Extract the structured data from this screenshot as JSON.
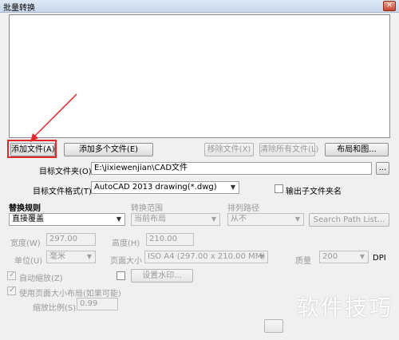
{
  "window": {
    "title": "批量转换",
    "close_glyph": "✕"
  },
  "buttons": {
    "add_file": "添加文件(A)",
    "add_multiple": "添加多个文件(E)",
    "remove_file": "移除文件(X)",
    "clear_all": "清除所有文件(L)",
    "layout_settings": "布局和图...",
    "browse": "...",
    "set_watermark": "设置水印..."
  },
  "target_folder": {
    "label": "目标文件夹(O)",
    "value": "E:\\jixiewenjian\\CAD文件"
  },
  "target_format": {
    "label": "目标文件格式(T)",
    "value": "AutoCAD 2013 drawing(*.dwg)"
  },
  "output_subfolder": {
    "label": "输出子文件夹名",
    "checked": false
  },
  "replace_rule": {
    "label": "替换规则",
    "value": "直接覆盖"
  },
  "convert_range": {
    "label": "转换范围",
    "value": "当前布局"
  },
  "sort_path": {
    "label": "排列路径",
    "value": "从不"
  },
  "search_path": {
    "label": "Search Path List..."
  },
  "width": {
    "label": "宽度(W)",
    "value": "297.00"
  },
  "height": {
    "label": "高度(H)",
    "value": "210.00"
  },
  "unit": {
    "label": "单位(U)",
    "value": "毫米"
  },
  "page_size": {
    "label": "页面大小",
    "value": "ISO A4 (297.00 x 210.00 MM)"
  },
  "quality": {
    "label": "质量",
    "value": "200",
    "unit": "DPI"
  },
  "auto_zoom": {
    "label": "自动缩放(Z)",
    "checked": true
  },
  "use_page_size": {
    "label": "使用页面大小布局(如果可能)",
    "checked": true
  },
  "zoom_ratio": {
    "label": "缩放比例(S)",
    "value": "0.99"
  },
  "watermark_overlay": "软件技巧",
  "colors": {
    "highlight": "#e0282b",
    "arrow": "#e0282b"
  }
}
